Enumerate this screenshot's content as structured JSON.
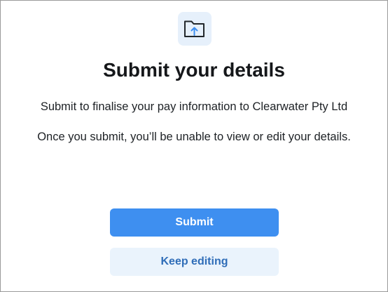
{
  "dialog": {
    "icon": "folder-upload-icon",
    "title": "Submit your details",
    "message_line_1": "Submit to finalise your pay information to Clearwater Pty Ltd",
    "message_line_2": "Once you submit, you’ll be unable to view or edit your details.",
    "primary_button_label": "Submit",
    "secondary_button_label": "Keep editing"
  },
  "colors": {
    "accent": "#3e8ff0",
    "icon_tile": "#e6f0fb",
    "secondary_button_bg": "#eaf3fc",
    "secondary_button_text": "#2f6db8",
    "title_text": "#15171a"
  }
}
